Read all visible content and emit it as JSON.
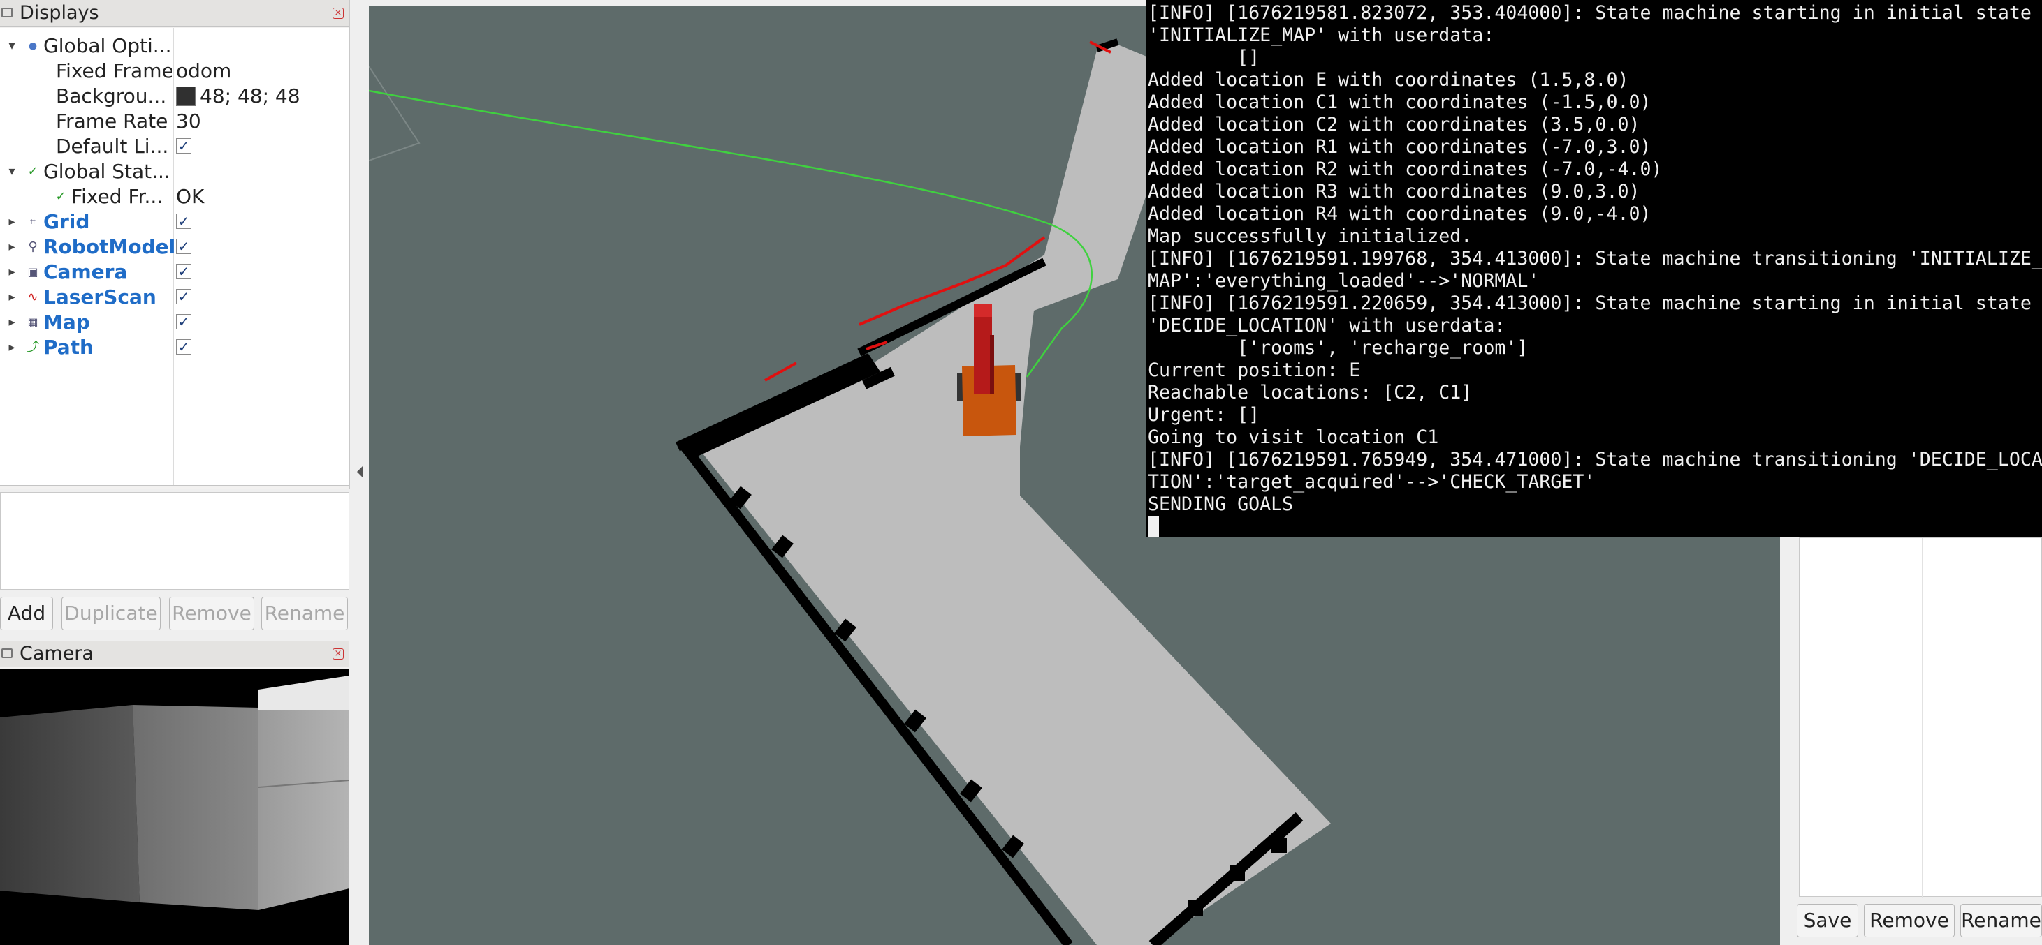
{
  "displays": {
    "title": "Displays",
    "rows": [
      {
        "label": "Global Opti...",
        "value": ""
      },
      {
        "label": "Fixed Frame",
        "value": "odom"
      },
      {
        "label": "Backgrou...",
        "value": "48; 48; 48"
      },
      {
        "label": "Frame Rate",
        "value": "30"
      },
      {
        "label": "Default Li...",
        "value": "✓"
      },
      {
        "label": "Global Stat...",
        "value": ""
      },
      {
        "label": "Fixed Fr...",
        "value": "OK"
      },
      {
        "label": "Grid",
        "value": "✓"
      },
      {
        "label": "RobotModel",
        "value": "✓"
      },
      {
        "label": "Camera",
        "value": "✓"
      },
      {
        "label": "LaserScan",
        "value": "✓"
      },
      {
        "label": "Map",
        "value": "✓"
      },
      {
        "label": "Path",
        "value": "✓"
      }
    ],
    "buttons": {
      "add": "Add",
      "duplicate": "Duplicate",
      "remove": "Remove",
      "rename": "Rename"
    }
  },
  "camera": {
    "title": "Camera"
  },
  "terminal": {
    "lines": [
      "[INFO] [1676219581.823072, 353.404000]: State machine starting in initial state",
      "'INITIALIZE_MAP' with userdata:",
      "        []",
      "Added location E with coordinates (1.5,8.0)",
      "Added location C1 with coordinates (-1.5,0.0)",
      "Added location C2 with coordinates (3.5,0.0)",
      "Added location R1 with coordinates (-7.0,3.0)",
      "Added location R2 with coordinates (-7.0,-4.0)",
      "Added location R3 with coordinates (9.0,3.0)",
      "Added location R4 with coordinates (9.0,-4.0)",
      "Map successfully initialized.",
      "[INFO] [1676219591.199768, 354.413000]: State machine transitioning 'INITIALIZE_",
      "MAP':'everything_loaded'-->'NORMAL'",
      "[INFO] [1676219591.220659, 354.413000]: State machine starting in initial state",
      "'DECIDE_LOCATION' with userdata:",
      "        ['rooms', 'recharge_room']",
      "Current position: E",
      "Reachable locations: [C2, C1]",
      "Urgent: []",
      "Going to visit location C1",
      "[INFO] [1676219591.765949, 354.471000]: State machine transitioning 'DECIDE_LOCA",
      "TION':'target_acquired'-->'CHECK_TARGET'",
      "SENDING GOALS"
    ]
  },
  "right_panel": {
    "buttons": {
      "save": "Save",
      "remove": "Remove",
      "rename": "Rename"
    }
  },
  "colors": {
    "viewport_bg": "#5e6b6a",
    "map_free": "#bdbdbd",
    "map_wall": "#000000",
    "path": "#3fd13f",
    "laser": "#e01010",
    "robot_body": "#c8560d"
  }
}
